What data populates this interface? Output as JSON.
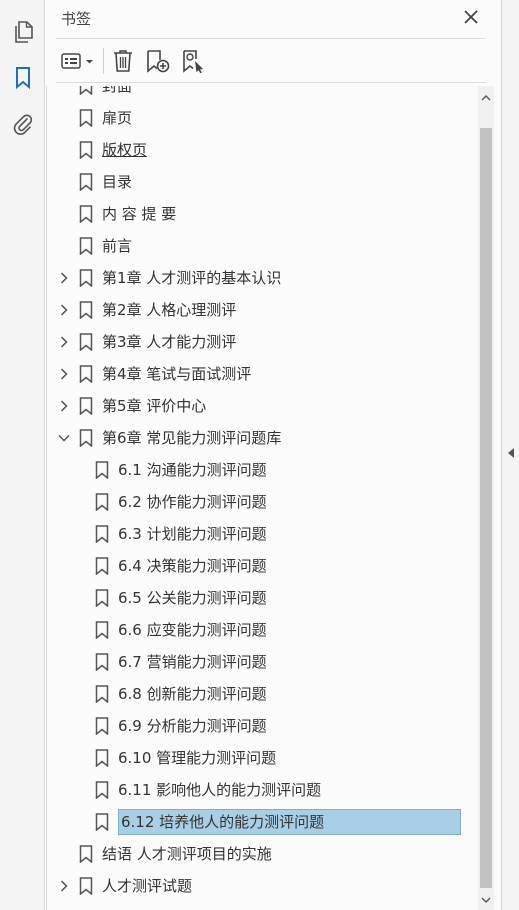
{
  "panel": {
    "title": "书签"
  },
  "tools": {
    "pages_icon": "pages-icon",
    "bookmarks_icon": "bookmark-icon",
    "attachments_icon": "paperclip-icon"
  },
  "colors": {
    "accent": "#1f6fbf",
    "selection": "#a9cfe6"
  },
  "bookmarks": [
    {
      "label": "封面",
      "level": 0,
      "chevron": "none"
    },
    {
      "label": "扉页",
      "level": 0,
      "chevron": "none"
    },
    {
      "label": "版权页",
      "level": 0,
      "chevron": "none",
      "underline": true
    },
    {
      "label": "目录",
      "level": 0,
      "chevron": "none"
    },
    {
      "label": "内 容 提 要",
      "level": 0,
      "chevron": "none"
    },
    {
      "label": "前言",
      "level": 0,
      "chevron": "none"
    },
    {
      "label": "第1章 人才测评的基本认识",
      "level": 0,
      "chevron": "right"
    },
    {
      "label": "第2章 人格心理测评",
      "level": 0,
      "chevron": "right"
    },
    {
      "label": "第3章 人才能力测评",
      "level": 0,
      "chevron": "right"
    },
    {
      "label": "第4章 笔试与面试测评",
      "level": 0,
      "chevron": "right"
    },
    {
      "label": "第5章 评价中心",
      "level": 0,
      "chevron": "right"
    },
    {
      "label": "第6章 常见能力测评问题库",
      "level": 0,
      "chevron": "down"
    },
    {
      "label": "6.1 沟通能力测评问题",
      "level": 1,
      "chevron": "none"
    },
    {
      "label": "6.2 协作能力测评问题",
      "level": 1,
      "chevron": "none"
    },
    {
      "label": "6.3 计划能力测评问题",
      "level": 1,
      "chevron": "none"
    },
    {
      "label": "6.4 决策能力测评问题",
      "level": 1,
      "chevron": "none"
    },
    {
      "label": "6.5 公关能力测评问题",
      "level": 1,
      "chevron": "none"
    },
    {
      "label": "6.6 应变能力测评问题",
      "level": 1,
      "chevron": "none"
    },
    {
      "label": "6.7 营销能力测评问题",
      "level": 1,
      "chevron": "none"
    },
    {
      "label": "6.8 创新能力测评问题",
      "level": 1,
      "chevron": "none"
    },
    {
      "label": "6.9 分析能力测评问题",
      "level": 1,
      "chevron": "none"
    },
    {
      "label": "6.10 管理能力测评问题",
      "level": 1,
      "chevron": "none"
    },
    {
      "label": "6.11 影响他人的能力测评问题",
      "level": 1,
      "chevron": "none"
    },
    {
      "label": "6.12 培养他人的能力测评问题",
      "level": 1,
      "chevron": "none",
      "selected": true
    },
    {
      "label": "结语 人才测评项目的实施",
      "level": 0,
      "chevron": "none"
    },
    {
      "label": "人才测评试题",
      "level": 0,
      "chevron": "right"
    }
  ]
}
